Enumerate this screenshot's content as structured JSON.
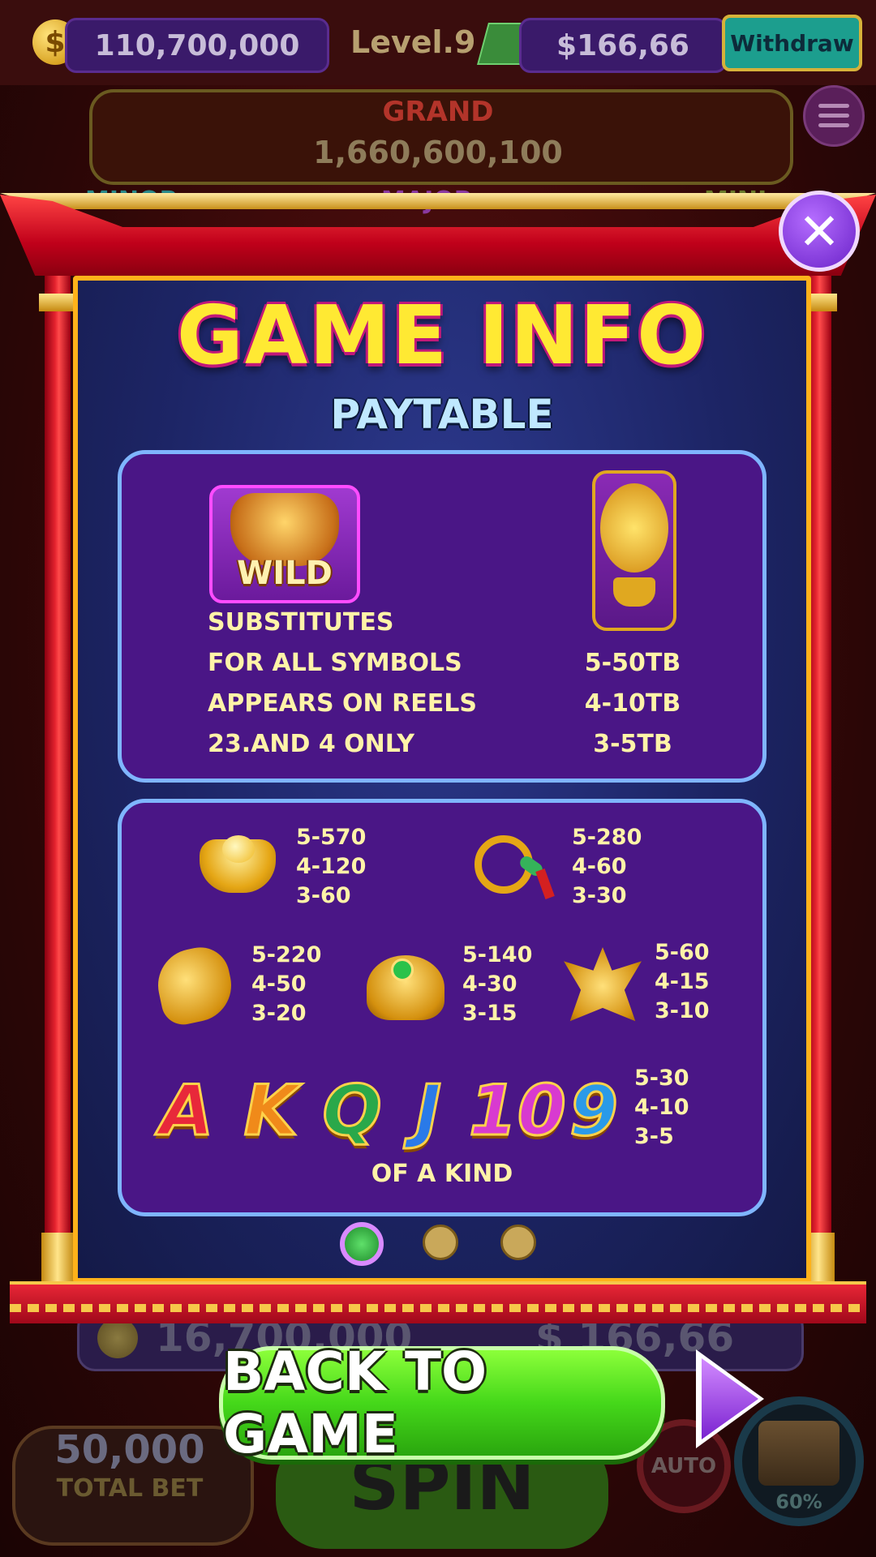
{
  "topbar": {
    "coins": "110,700,000",
    "level": "Level.9",
    "cash": "$166,66",
    "withdraw_label": "Withdraw"
  },
  "jackpots": {
    "grand_label": "GRAND",
    "grand_value": "1,660,600,100",
    "minor_label": "MINOR",
    "major_label": "MAJOR",
    "mini_label": "MINI"
  },
  "modal": {
    "title": "GAME INFO",
    "subtitle": "PAYTABLE",
    "close_icon": "close-icon",
    "wild": {
      "label": "WILD",
      "lines": [
        "SUBSTITUTES",
        "FOR ALL SYMBOLS",
        "APPEARS ON REELS",
        "23.AND 4 ONLY"
      ]
    },
    "money_tree": {
      "pays": [
        "5-50TB",
        "4-10TB",
        "3-5TB"
      ]
    },
    "symbols": [
      {
        "icon": "gold-ingot-icon",
        "pays": [
          "5-570",
          "4-120",
          "3-60"
        ]
      },
      {
        "icon": "jade-bracelet-icon",
        "pays": [
          "5-280",
          "4-60",
          "3-30"
        ]
      },
      {
        "icon": "koi-fish-icon",
        "pays": [
          "5-220",
          "4-50",
          "3-20"
        ]
      },
      {
        "icon": "golden-toad-icon",
        "pays": [
          "5-140",
          "4-30",
          "3-15"
        ]
      },
      {
        "icon": "phoenix-icon",
        "pays": [
          "5-60",
          "4-15",
          "3-10"
        ]
      }
    ],
    "cards": {
      "letters": [
        "A",
        "K",
        "Q",
        "J",
        "10",
        "9"
      ],
      "colors": [
        "#e8283a",
        "#f08a1a",
        "#2aa84a",
        "#2a7ae8",
        "#d83ad0",
        "#2a9ae8"
      ],
      "pays": [
        "5-30",
        "4-10",
        "3-5"
      ]
    },
    "of_a_kind": "OF A KIND",
    "pagination": {
      "current": 1,
      "total": 3
    }
  },
  "hud": {
    "balance": "16,700,000",
    "cash": "$ 166,66",
    "total_bet_value": "50,000",
    "total_bet_label": "TOTAL BET",
    "spin_label": "SPIN",
    "auto_label": "AUTO",
    "chest_progress": "60%"
  },
  "back_button_label": "BACK TO GAME",
  "colors": {
    "title_yellow": "#ffe933",
    "panel_purple": "#4a1686",
    "accent_green": "#45d81a",
    "frame_red": "#e3222e"
  }
}
